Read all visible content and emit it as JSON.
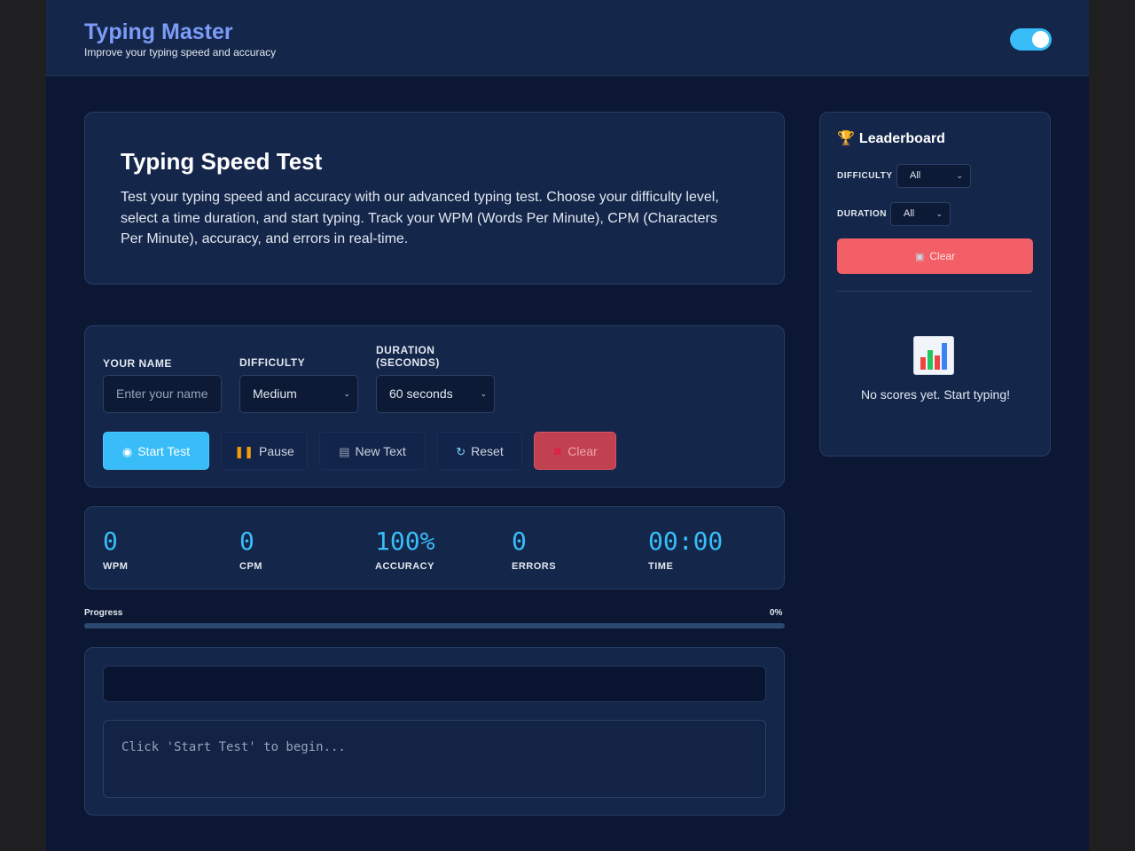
{
  "header": {
    "title": "Typing Master",
    "subtitle": "Improve your typing speed and accuracy"
  },
  "intro": {
    "title": "Typing Speed Test",
    "text": "Test your typing speed and accuracy with our advanced typing test. Choose your difficulty level, select a time duration, and start typing. Track your WPM (Words Per Minute), CPM (Characters Per Minute), accuracy, and errors in real-time."
  },
  "controls": {
    "name_label": "YOUR NAME",
    "name_placeholder": "Enter your name",
    "difficulty_label": "DIFFICULTY",
    "difficulty_value": "Medium",
    "duration_label_1": "DURATION",
    "duration_label_2": "(SECONDS)",
    "duration_value": "60 seconds",
    "start_label": "Start Test",
    "pause_label": "Pause",
    "new_text_label": "New Text",
    "reset_label": "Reset",
    "clear_label": "Clear"
  },
  "stats": {
    "wpm_value": "0",
    "wpm_label": "WPM",
    "cpm_value": "0",
    "cpm_label": "CPM",
    "accuracy_value": "100%",
    "accuracy_label": "ACCURACY",
    "errors_value": "0",
    "errors_label": "ERRORS",
    "time_value": "00:00",
    "time_label": "TIME"
  },
  "progress": {
    "label": "Progress",
    "percent_text": "0%",
    "fraction": 0
  },
  "typing": {
    "placeholder": "Click 'Start Test' to begin..."
  },
  "leaderboard": {
    "title": "Leaderboard",
    "difficulty_label": "DIFFICULTY",
    "difficulty_value": "All",
    "duration_label": "DURATION",
    "duration_value": "All",
    "clear_label": "Clear",
    "empty_text": "No scores yet. Start typing!"
  },
  "icons": {
    "start": "target-icon",
    "pause": "pause-icon",
    "new_text": "document-icon",
    "reset": "refresh-icon",
    "clear": "cross-icon",
    "leaderboard": "trophy-icon",
    "lb_clear": "trash-icon",
    "empty": "bar-chart-icon"
  },
  "colors": {
    "accent": "#38bdf8",
    "danger": "#f25f66",
    "brand": "#7c9cf8"
  }
}
